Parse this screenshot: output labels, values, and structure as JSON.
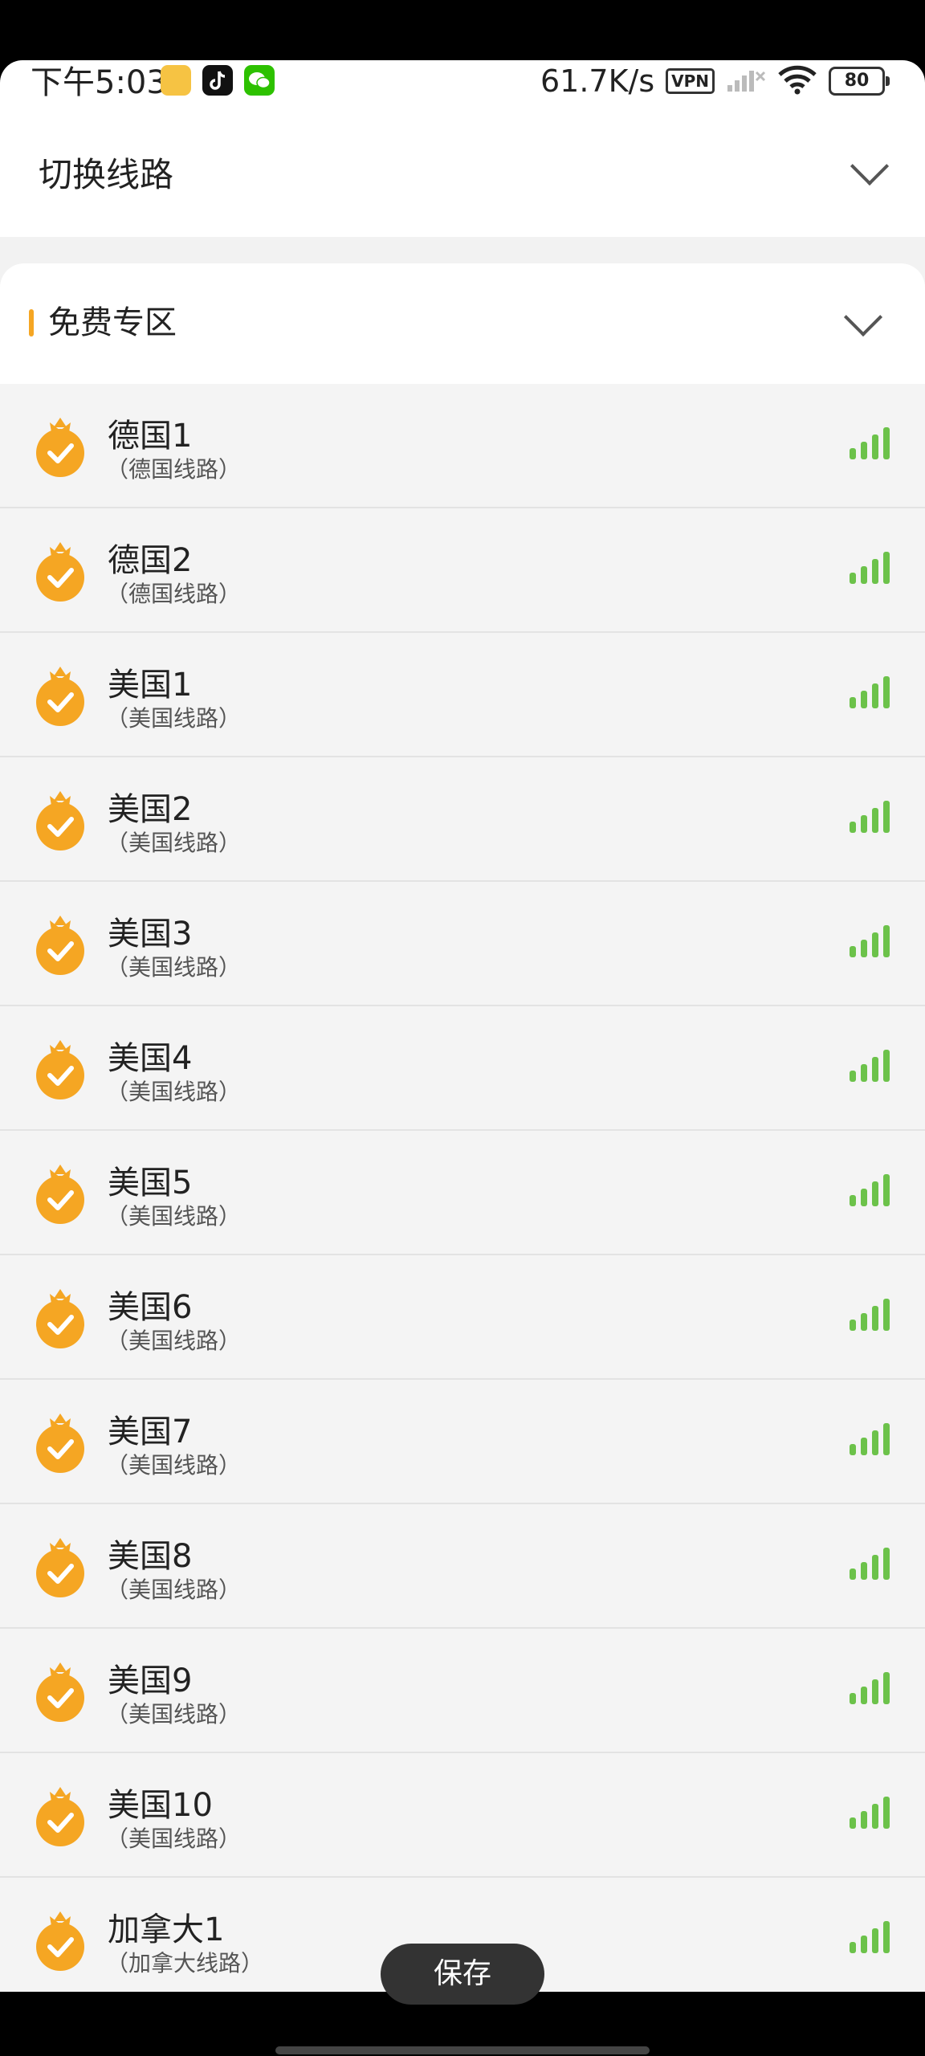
{
  "status_bar": {
    "time": "下午5:03",
    "net_speed": "61.7K/s",
    "vpn": "VPN",
    "battery": "80"
  },
  "switch_line": {
    "title": "切换线路"
  },
  "zone": {
    "title": "免费专区",
    "items": [
      {
        "name": "德国1",
        "sub": "（德国线路）"
      },
      {
        "name": "德国2",
        "sub": "（德国线路）"
      },
      {
        "name": "美国1",
        "sub": "（美国线路）"
      },
      {
        "name": "美国2",
        "sub": "（美国线路）"
      },
      {
        "name": "美国3",
        "sub": "（美国线路）"
      },
      {
        "name": "美国4",
        "sub": "（美国线路）"
      },
      {
        "name": "美国5",
        "sub": "（美国线路）"
      },
      {
        "name": "美国6",
        "sub": "（美国线路）"
      },
      {
        "name": "美国7",
        "sub": "（美国线路）"
      },
      {
        "name": "美国8",
        "sub": "（美国线路）"
      },
      {
        "name": "美国9",
        "sub": "（美国线路）"
      },
      {
        "name": "美国10",
        "sub": "（美国线路）"
      },
      {
        "name": "加拿大1",
        "sub": "（加拿大线路）"
      }
    ]
  },
  "toast": {
    "label": "保存"
  },
  "colors": {
    "accent": "#f5a623",
    "signal": "#6cc24a"
  },
  "icons": {
    "medal": "medal-check-icon",
    "signal": "signal-strength-icon",
    "chevron": "chevron-down-icon"
  }
}
